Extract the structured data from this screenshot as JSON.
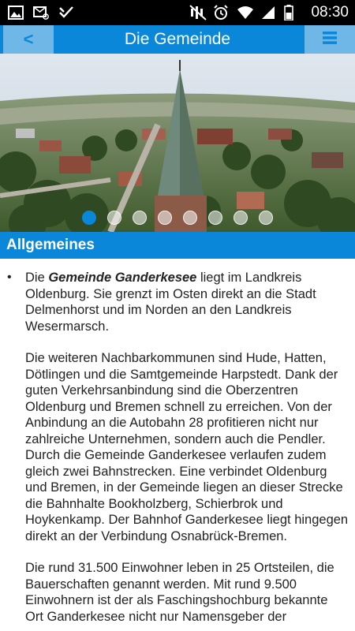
{
  "status_bar": {
    "time": "08:30",
    "left_icons": [
      "gallery-icon",
      "email-icon",
      "checkmark-icon"
    ],
    "right_icons": [
      "mute-icon",
      "alarm-icon",
      "wifi-icon",
      "signal-icon",
      "battery-icon"
    ]
  },
  "app_bar": {
    "back_label": "<",
    "title": "Die Gemeinde",
    "menu_icon": "hamburger-menu-icon"
  },
  "carousel": {
    "slide_count": 8,
    "active_index": 0
  },
  "section": {
    "title": "Allgemeines"
  },
  "content": {
    "paragraph_1_prefix": "Die ",
    "paragraph_1_emphasis": "Gemeinde Ganderkesee",
    "paragraph_1_suffix": " liegt im Landkreis Oldenburg. Sie grenzt im Osten direkt an die Stadt Delmenhorst und im Norden an den Landkreis Wesermarsch.",
    "paragraph_2": "Die weiteren Nachbarkommunen sind Hude, Hatten, Dötlingen und die Samtgemeinde Harpstedt. Dank der guten Verkehrsanbindung sind die Oberzentren Oldenburg und Bremen schnell zu erreichen. Von der Anbindung an die Autobahn 28 profitieren nicht nur zahlreiche Unternehmen, sondern auch die Pendler. Durch die Gemeinde Ganderkesee verlaufen zudem gleich zwei Bahnstrecken. Eine verbindet Oldenburg und Bremen, in der Gemeinde liegen an dieser Strecke die Bahnhalte Bookholzberg, Schierbrok und Hoykenkamp. Der Bahnhof Ganderkesee liegt hingegen direkt an der Verbindung Osnabrück-Bremen.",
    "paragraph_3": "Die rund 31.500 Einwohner leben in 25 Ortsteilen, die Bauerschaften genannt werden. Mit rund 9.500 Einwohnern ist der als Faschingshochburg bekannte Ort Ganderkesee nicht nur Namensgeber der"
  }
}
